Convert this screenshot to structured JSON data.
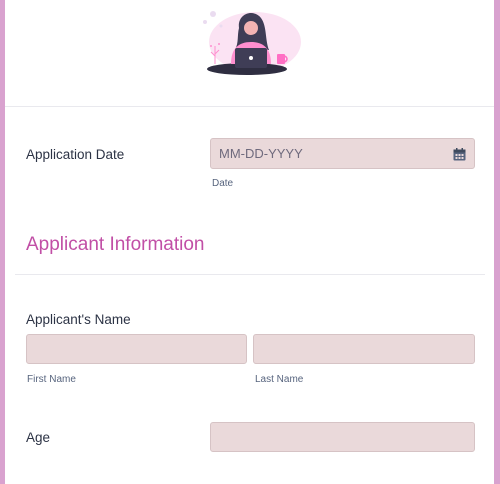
{
  "colors": {
    "page_background": "#d9a2cf",
    "accent": "#c14fa6",
    "input_background": "#ead9da"
  },
  "header": {
    "illustration_icon": "person-at-laptop-illustration"
  },
  "application_date": {
    "label": "Application Date",
    "placeholder": "MM-DD-YYYY",
    "sublabel": "Date",
    "icon": "calendar-icon"
  },
  "section": {
    "title": "Applicant Information"
  },
  "applicant_name": {
    "label": "Applicant's Name",
    "first_sublabel": "First Name",
    "last_sublabel": "Last Name",
    "first_value": "",
    "last_value": ""
  },
  "age": {
    "label": "Age",
    "value": ""
  }
}
